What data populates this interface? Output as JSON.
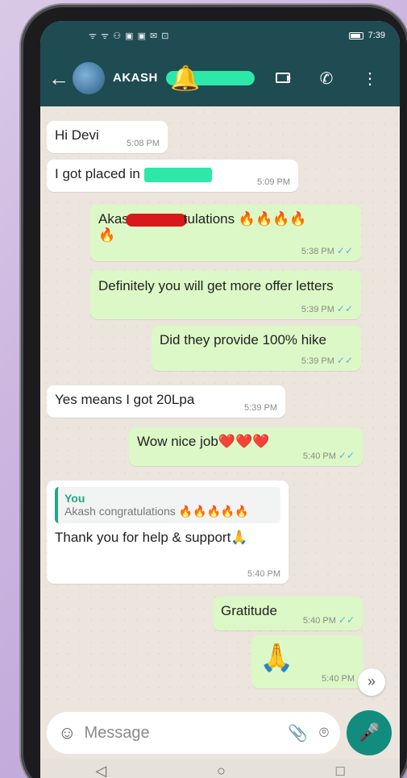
{
  "statusbar": {
    "left": "ᯤ ᯤ ⚇ ▣ ▣ ✉ ⊡",
    "time": "7:39"
  },
  "header": {
    "back_label": "←",
    "contact_name": "AKASH",
    "more_label": "⋮"
  },
  "messages": [
    {
      "type": "in",
      "text": "Hi Devi",
      "time": "5:08 PM"
    },
    {
      "type": "in",
      "text": "I got placed in",
      "time": "5:09 PM"
    },
    {
      "type": "out",
      "text_start": "Akas",
      "text_end": "tulations 🔥🔥🔥🔥",
      "text_line2": "🔥",
      "time": "5:38 PM"
    },
    {
      "type": "out",
      "text": "Definitely you will get more offer letters",
      "time": "5:39 PM"
    },
    {
      "type": "out",
      "text": "Did they provide 100% hike",
      "time": "5:39 PM"
    },
    {
      "type": "in",
      "text": "Yes means I got 20Lpa",
      "time": "5:39 PM"
    },
    {
      "type": "out",
      "text": "Wow nice job❤️❤️❤️",
      "time": "5:40 PM"
    },
    {
      "type": "in",
      "quote_name": "You",
      "quote_text": "Akash congratulations 🔥🔥🔥🔥🔥",
      "text": "Thank you for help & support🙏",
      "time": "5:40 PM"
    },
    {
      "type": "out",
      "text": "Gratitude",
      "time": "5:40 PM"
    },
    {
      "type": "out",
      "text": "🙏",
      "time": "5:40 PM"
    }
  ],
  "ticks": "✓✓",
  "composer": {
    "placeholder": "Message"
  },
  "colors": {
    "header": "#1f4b53",
    "outgoing": "#dcf8c6",
    "incoming": "#ffffff",
    "accent": "#128c7e"
  },
  "icons": [
    "back-icon",
    "bell-icon",
    "video-call-icon",
    "phone-call-icon",
    "more-icon",
    "emoji-icon",
    "attach-icon",
    "camera-icon",
    "mic-icon",
    "scroll-down-icon",
    "nav-back-icon",
    "nav-home-icon",
    "nav-recent-icon"
  ]
}
